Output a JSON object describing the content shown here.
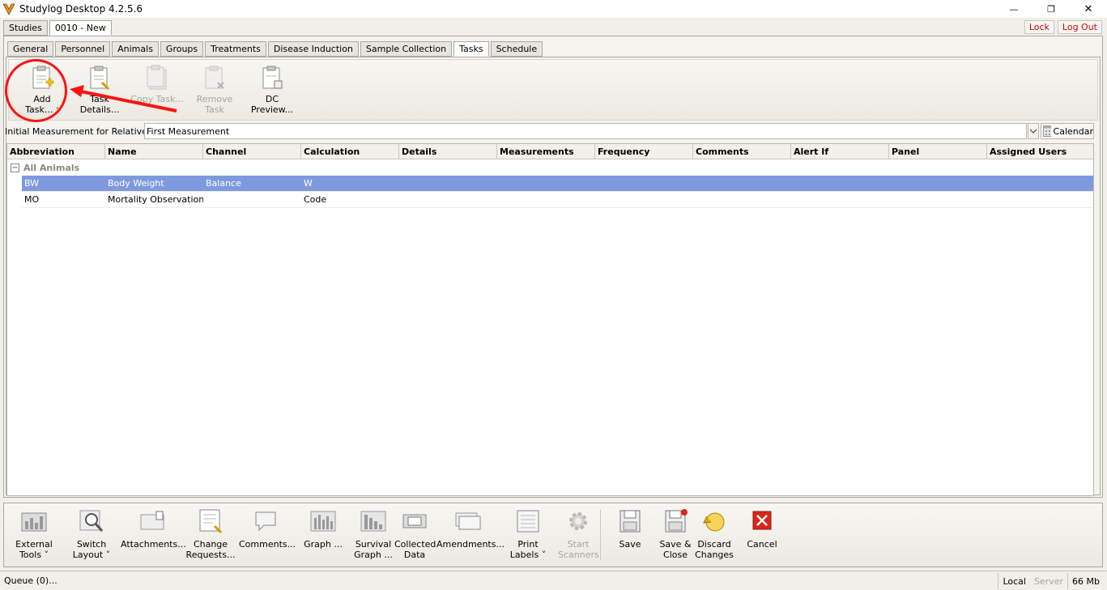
{
  "window": {
    "title": "Studylog Desktop 4.2.5.6",
    "minimize_glyph": "—",
    "restore_glyph": "❐",
    "close_glyph": "✕"
  },
  "study_tabs": [
    "Studies",
    "0010 - New"
  ],
  "top_right": {
    "lock": "Lock",
    "logout": "Log Out"
  },
  "sub_tabs": [
    "General",
    "Personnel",
    "Animals",
    "Groups",
    "Treatments",
    "Disease Induction",
    "Sample Collection",
    "Tasks",
    "Schedule"
  ],
  "active_sub_tab": "Tasks",
  "task_toolbar": {
    "add_task": {
      "line1": "Add",
      "line2": "Task...",
      "caret": "˅"
    },
    "task_details": {
      "line1": "Task",
      "line2": "Details..."
    },
    "copy_task": {
      "line1": "Copy Task..."
    },
    "remove_task": {
      "line1": "Remove Task"
    },
    "dc_preview": {
      "line1": "DC",
      "line2": "Preview..."
    }
  },
  "relatives": {
    "label": "Initial Measurement for Relatives:",
    "value": "First Measurement",
    "calendar_label": "Calendar"
  },
  "grid": {
    "columns": [
      "Abbreviation",
      "Name",
      "Channel",
      "Calculation",
      "Details",
      "Measurements",
      "Frequency",
      "Comments",
      "Alert If",
      "Panel",
      "Assigned Users"
    ],
    "group_toggle": "−",
    "group": "All Animals",
    "rows": [
      {
        "abbr": "BW",
        "name": "Body Weight",
        "channel": "Balance",
        "calculation": "W"
      },
      {
        "abbr": "MO",
        "name": "Mortality Observation",
        "channel": "",
        "calculation": "Code"
      }
    ]
  },
  "bottom_toolbar": {
    "external_tools": {
      "line1": "External",
      "line2": "Tools ˅"
    },
    "switch_layout": {
      "line1": "Switch",
      "line2": "Layout ˅"
    },
    "attachments": {
      "line1": "Attachments..."
    },
    "change_requests": {
      "line1": "Change",
      "line2": "Requests..."
    },
    "comments": {
      "line1": "Comments..."
    },
    "graph": {
      "line1": "Graph ..."
    },
    "survival_graph": {
      "line1": "Survival",
      "line2": "Graph ..."
    },
    "collected_data": {
      "line1": "Collected",
      "line2": "Data"
    },
    "amendments": {
      "line1": "Amendments..."
    },
    "print_labels": {
      "line1": "Print",
      "line2": "Labels ˅"
    },
    "start_scanners": {
      "line1": "Start",
      "line2": "Scanners"
    },
    "save": {
      "line1": "Save"
    },
    "save_close": {
      "line1": "Save &",
      "line2": "Close"
    },
    "discard": {
      "line1": "Discard",
      "line2": "Changes"
    },
    "cancel": {
      "line1": "Cancel"
    }
  },
  "status": {
    "queue": "Queue (0)...",
    "local": "Local",
    "server": "Server",
    "memory": "66 Mb"
  }
}
